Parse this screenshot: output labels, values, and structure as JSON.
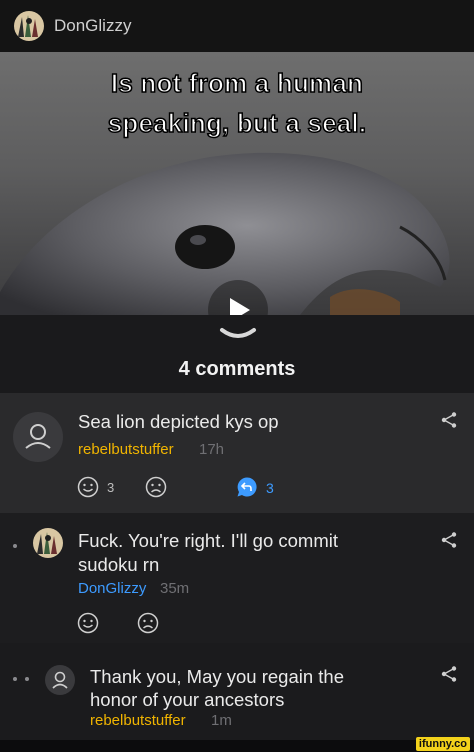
{
  "post": {
    "author": "DonGlizzy",
    "caption_line1": "Is not from a human",
    "caption_line2": "speaking, but a seal.",
    "comments_label": "4 comments"
  },
  "comments": [
    {
      "text": "Sea lion depicted kys op",
      "author": "rebelbutstuffer",
      "time": "17h",
      "smile_count": "3",
      "reply_count": "3",
      "author_color": "#f0b400"
    },
    {
      "text_line1": "Fuck. You're right. I'll go commit",
      "text_line2": "sudoku rn",
      "author": "DonGlizzy",
      "time": "35m",
      "author_color": "#3d9bff"
    },
    {
      "text_line1": "Thank you, May you regain the",
      "text_line2": "honor of your ancestors",
      "author": "rebelbutstuffer",
      "time": "1m",
      "author_color": "#f0b400"
    }
  ],
  "watermark": "ifunny.co",
  "icons": [
    "user-avatar-icon",
    "smile-icon",
    "frown-icon",
    "reply-icon",
    "share-icon",
    "play-icon",
    "chevron-down-icon"
  ],
  "colors": {
    "accent_blue": "#3d9bff",
    "author_yellow": "#f0b400",
    "background": "#1a1a1c"
  }
}
